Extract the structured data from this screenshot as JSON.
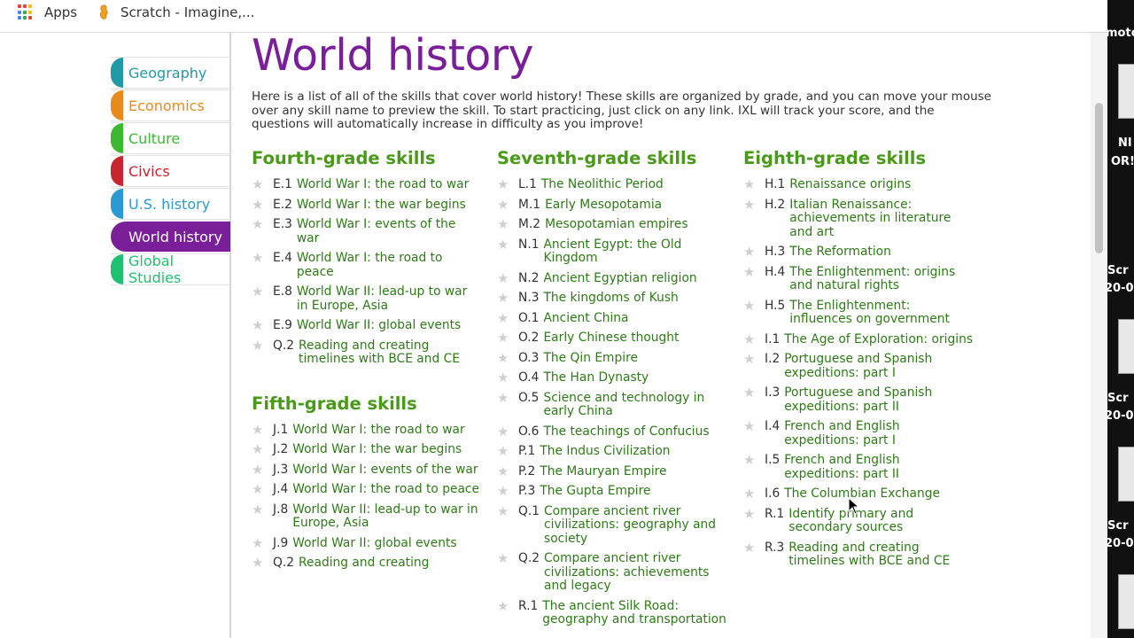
{
  "bookmarks": {
    "apps_label": "Apps",
    "scratch_label": "Scratch - Imagine,..."
  },
  "sidebar": {
    "items": [
      {
        "label": "Geography",
        "color": "#1f9aa6",
        "active": false
      },
      {
        "label": "Economics",
        "color": "#e88a1d",
        "active": false
      },
      {
        "label": "Culture",
        "color": "#3eb733",
        "active": false
      },
      {
        "label": "Civics",
        "color": "#c8262e",
        "active": false
      },
      {
        "label": "U.S. history",
        "color": "#2a9ad1",
        "active": false
      },
      {
        "label": "World history",
        "color": "#7a1f99",
        "active": true
      },
      {
        "label": "Global Studies",
        "color": "#1fc070",
        "active": false
      }
    ]
  },
  "main": {
    "title": "World history",
    "intro": "Here is a list of all of the skills that cover world history! These skills are organized by grade, and you can move your mouse over any skill name to preview the skill. To start practicing, just click on any link. IXL will track your score, and the questions will automatically increase in difficulty as you improve!"
  },
  "columns": [
    {
      "sections": [
        {
          "heading": "Fourth-grade skills",
          "skills": [
            {
              "code": "E.1",
              "name": "World War I: the road to war"
            },
            {
              "code": "E.2",
              "name": "World War I: the war begins"
            },
            {
              "code": "E.3",
              "name": "World War I: events of the war"
            },
            {
              "code": "E.4",
              "name": "World War I: the road to peace"
            },
            {
              "code": "E.8",
              "name": "World War II: lead-up to war in Europe, Asia"
            },
            {
              "code": "E.9",
              "name": "World War II: global events"
            },
            {
              "code": "Q.2",
              "name": "Reading and creating timelines with BCE and CE"
            }
          ]
        },
        {
          "heading": "Fifth-grade skills",
          "skills": [
            {
              "code": "J.1",
              "name": "World War I: the road to war"
            },
            {
              "code": "J.2",
              "name": "World War I: the war begins"
            },
            {
              "code": "J.3",
              "name": "World War I: events of the war"
            },
            {
              "code": "J.4",
              "name": "World War I: the road to peace"
            },
            {
              "code": "J.8",
              "name": "World War II: lead-up to war in Europe, Asia"
            },
            {
              "code": "J.9",
              "name": "World War II: global events"
            },
            {
              "code": "Q.2",
              "name": "Reading and creating"
            }
          ]
        }
      ]
    },
    {
      "sections": [
        {
          "heading": "Seventh-grade skills",
          "skills": [
            {
              "code": "L.1",
              "name": "The Neolithic Period"
            },
            {
              "code": "M.1",
              "name": "Early Mesopotamia"
            },
            {
              "code": "M.2",
              "name": "Mesopotamian empires"
            },
            {
              "code": "N.1",
              "name": "Ancient Egypt: the Old Kingdom"
            },
            {
              "code": "N.2",
              "name": "Ancient Egyptian religion"
            },
            {
              "code": "N.3",
              "name": "The kingdoms of Kush"
            },
            {
              "code": "O.1",
              "name": "Ancient China"
            },
            {
              "code": "O.2",
              "name": "Early Chinese thought"
            },
            {
              "code": "O.3",
              "name": "The Qin Empire"
            },
            {
              "code": "O.4",
              "name": "The Han Dynasty"
            },
            {
              "code": "O.5",
              "name": "Science and technology in early China"
            },
            {
              "code": "O.6",
              "name": "The teachings of Confucius"
            },
            {
              "code": "P.1",
              "name": "The Indus Civilization"
            },
            {
              "code": "P.2",
              "name": "The Mauryan Empire"
            },
            {
              "code": "P.3",
              "name": "The Gupta Empire"
            },
            {
              "code": "Q.1",
              "name": "Compare ancient river civilizations: geography and society"
            },
            {
              "code": "Q.2",
              "name": "Compare ancient river civilizations: achievements and legacy"
            },
            {
              "code": "R.1",
              "name": "The ancient Silk Road: geography and transportation"
            }
          ]
        }
      ]
    },
    {
      "sections": [
        {
          "heading": "Eighth-grade skills",
          "skills": [
            {
              "code": "H.1",
              "name": "Renaissance origins"
            },
            {
              "code": "H.2",
              "name": "Italian Renaissance: achievements in literature and art"
            },
            {
              "code": "H.3",
              "name": "The Reformation"
            },
            {
              "code": "H.4",
              "name": "The Enlightenment: origins and natural rights"
            },
            {
              "code": "H.5",
              "name": "The Enlightenment: influences on government"
            },
            {
              "code": "I.1",
              "name": "The Age of Exploration: origins"
            },
            {
              "code": "I.2",
              "name": "Portuguese and Spanish expeditions: part I"
            },
            {
              "code": "I.3",
              "name": "Portuguese and Spanish expeditions: part II"
            },
            {
              "code": "I.4",
              "name": "French and English expeditions: part I"
            },
            {
              "code": "I.5",
              "name": "French and English expeditions: part II"
            },
            {
              "code": "I.6",
              "name": "The Columbian Exchange"
            },
            {
              "code": "R.1",
              "name": "Identify primary and secondary sources"
            },
            {
              "code": "R.3",
              "name": "Reading and creating timelines with BCE and CE"
            }
          ]
        }
      ]
    }
  ],
  "edge": {
    "texts": [
      "moto",
      "NI",
      "OR!",
      "Scr",
      "20-0",
      "Scr",
      "20-0",
      "Scr",
      "20-0"
    ]
  }
}
